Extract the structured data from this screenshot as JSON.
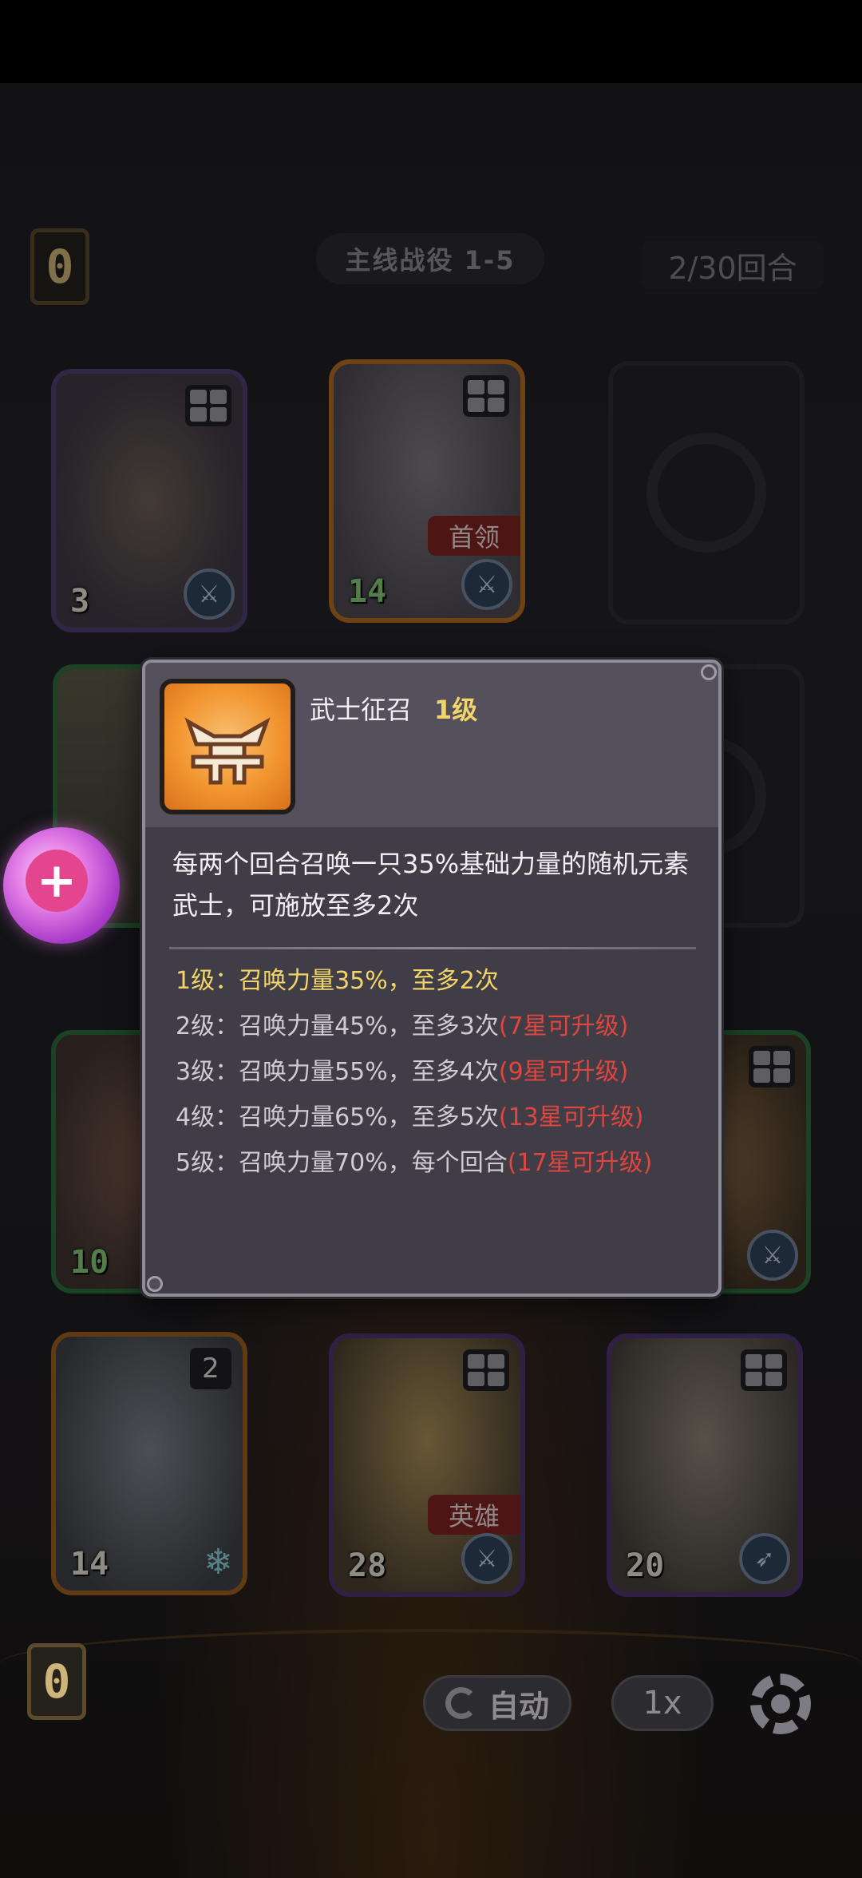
{
  "header": {
    "left_counter": "0",
    "stage_title": "主线战役 1-5",
    "round_count": "2/30回合"
  },
  "bottom_counter": "0",
  "cards": [
    {
      "id": "card-toad",
      "power": "3",
      "tag": "",
      "colors": {
        "frame": "#6a4fa0",
        "art": "#4d4058"
      }
    },
    {
      "id": "card-samurai",
      "power": "14",
      "tag": "首领",
      "colors": {
        "frame": "#e08a2b",
        "art": "#6d6a70"
      }
    },
    {
      "id": "card-green-warrior",
      "power": "",
      "tag": "",
      "colors": {
        "frame": "#3e9a58",
        "art": "#8b8a62"
      }
    },
    {
      "id": "card-boar",
      "power": "10",
      "tag": "",
      "colors": {
        "frame": "#3e9a58",
        "art": "#7a5a4c"
      }
    },
    {
      "id": "card-beast-right",
      "power": "",
      "tag": "",
      "colors": {
        "frame": "#3e9a58",
        "art": "#86613a"
      }
    },
    {
      "id": "card-ice-dragon",
      "power": "14",
      "tag": "",
      "colors": {
        "frame": "#e08a2b",
        "art": "#707880"
      }
    },
    {
      "id": "card-hero",
      "power": "28",
      "tag": "英雄",
      "colors": {
        "frame": "#7a4aa8",
        "art": "#a48a4c"
      }
    },
    {
      "id": "card-archer",
      "power": "20",
      "tag": "",
      "colors": {
        "frame": "#7a4aa8",
        "art": "#807869"
      }
    }
  ],
  "popup": {
    "skill_name": "武士征召",
    "skill_level": "1级",
    "description": "每两个回合召唤一只35%基础力量的随机元素武士，可施放至多2次",
    "levels": [
      {
        "text": "1级：召唤力量35%，至多2次",
        "req": "",
        "active": true
      },
      {
        "text": "2级：召唤力量45%，至多3次",
        "req": "(7星可升级)",
        "active": false
      },
      {
        "text": "3级：召唤力量55%，至多4次",
        "req": "(9星可升级)",
        "active": false
      },
      {
        "text": "4级：召唤力量65%，至多5次",
        "req": "(13星可升级)",
        "active": false
      },
      {
        "text": "5级：召唤力量70%，每个回合",
        "req": "(17星可升级)",
        "active": false
      }
    ]
  },
  "controls": {
    "auto_label": "自动",
    "speed_label": "1x"
  }
}
